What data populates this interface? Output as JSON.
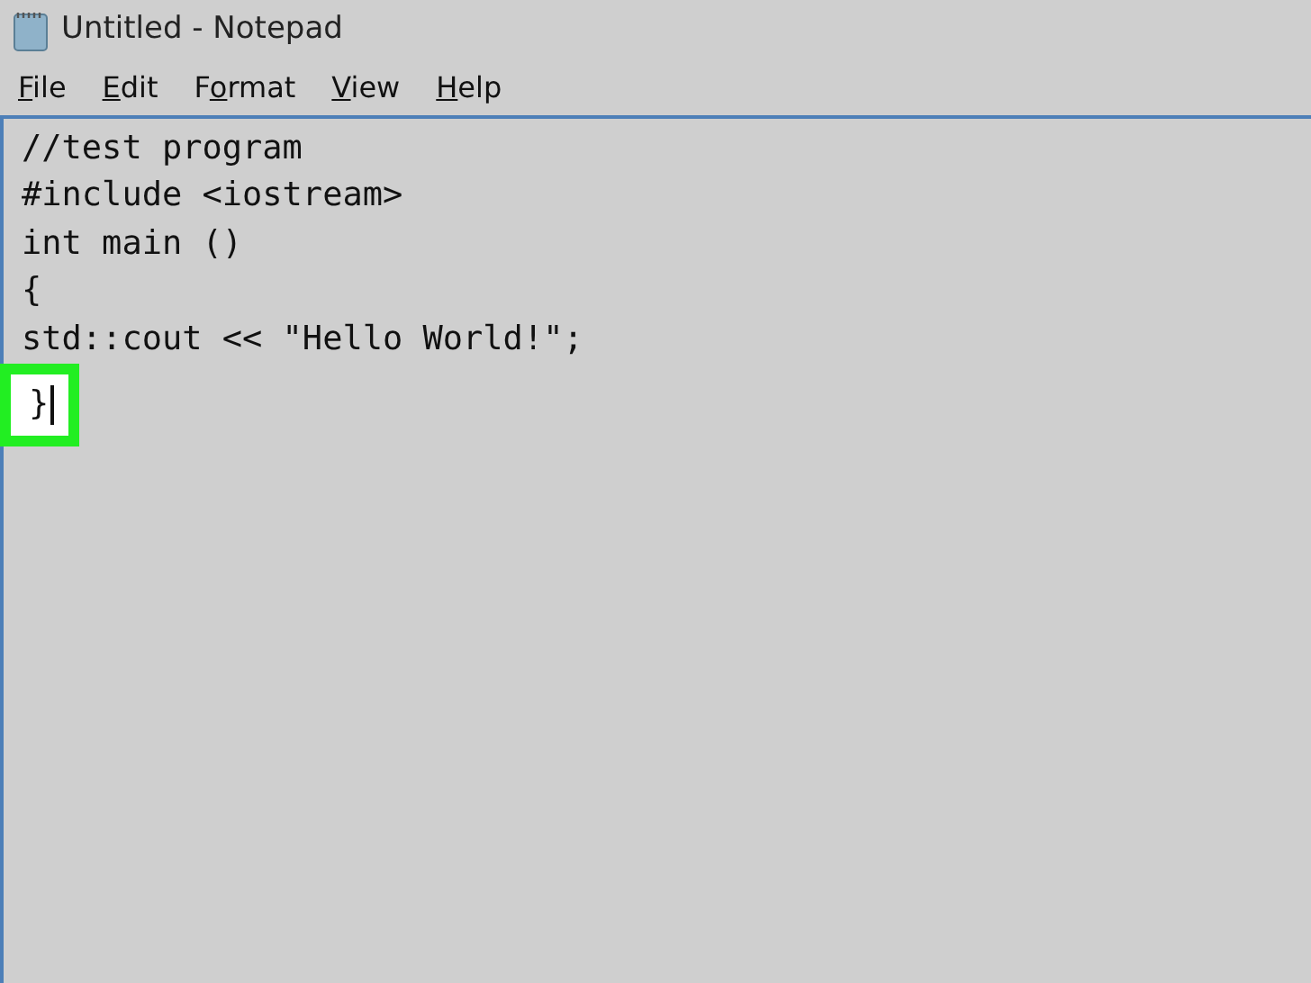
{
  "window": {
    "title": "Untitled - Notepad"
  },
  "menu": [
    {
      "access_key": "F",
      "label_after": "ile"
    },
    {
      "access_key": "E",
      "label_after": "dit"
    },
    {
      "label_before": "F",
      "access_key": "o",
      "label_after": "rmat"
    },
    {
      "access_key": "V",
      "label_after": "iew"
    },
    {
      "access_key": "H",
      "label_after": "elp"
    }
  ],
  "editor": {
    "lines": [
      {
        "text": "//test program",
        "highlighted": false
      },
      {
        "text": "#include <iostream>",
        "highlighted": false
      },
      {
        "text": "int main ()",
        "highlighted": false
      },
      {
        "text": "{",
        "highlighted": false
      },
      {
        "text": "std::cout << \"Hello World!\";",
        "highlighted": false
      },
      {
        "text": "}",
        "highlighted": true
      }
    ]
  }
}
